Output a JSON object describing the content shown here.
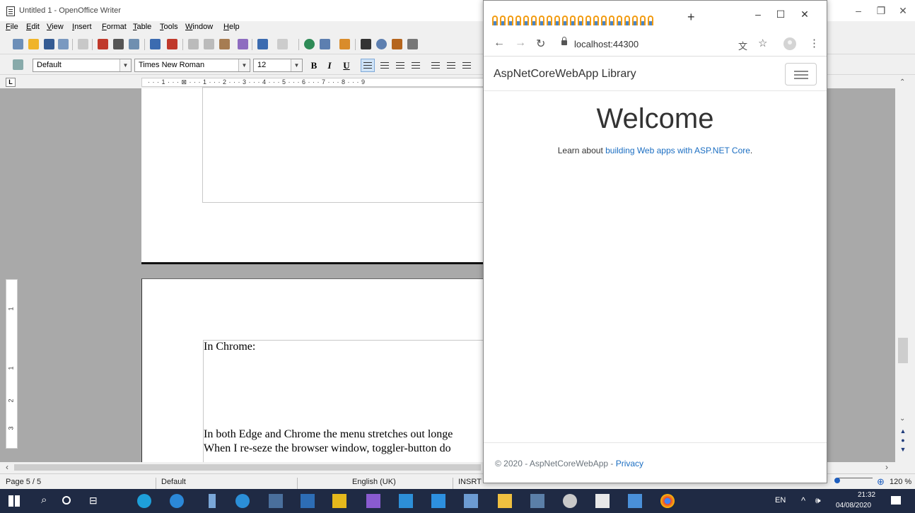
{
  "writer": {
    "title": "Untitled 1 - OpenOffice Writer",
    "menu": [
      "File",
      "Edit",
      "View",
      "Insert",
      "Format",
      "Table",
      "Tools",
      "Window",
      "Help"
    ],
    "paragraph_style": "Default",
    "font_name": "Times New Roman",
    "font_size": "12",
    "ruler_text": "· · · 1 · · · ⊠ · · · 1 · · · 2 · · · 3 · · · 4 · · · 5 · · · 6 · · · 7 · · · 8 · · · 9",
    "ruler_corner": "L",
    "vruler_marks": [
      "1",
      "2",
      "3"
    ],
    "doc_line_1": "In Chrome:",
    "doc_line_2": "In both Edge and Chrome the menu stretches out longe",
    "doc_line_3": "When I re-seze the browser window, toggler-button do",
    "status": {
      "page": "Page 5 / 5",
      "style": "Default",
      "language": "English (UK)",
      "mode": "INSRT",
      "zoom": "120 %"
    }
  },
  "chrome": {
    "new_tab": "+",
    "url": "localhost:44300",
    "brand": "AspNetCoreWebApp Library",
    "welcome": "Welcome",
    "learn_prefix": "Learn about ",
    "learn_link": "building Web apps with ASP.NET Core",
    "learn_suffix": ".",
    "footer_text": "© 2020 - AspNetCoreWebApp - ",
    "footer_link": "Privacy"
  },
  "taskbar": {
    "lang": "EN",
    "time": "21:32",
    "date": "04/08/2020"
  },
  "colors": {
    "link": "#1b6ec2",
    "taskbar": "#1f2a44",
    "doc_background": "#a9a9a9"
  }
}
